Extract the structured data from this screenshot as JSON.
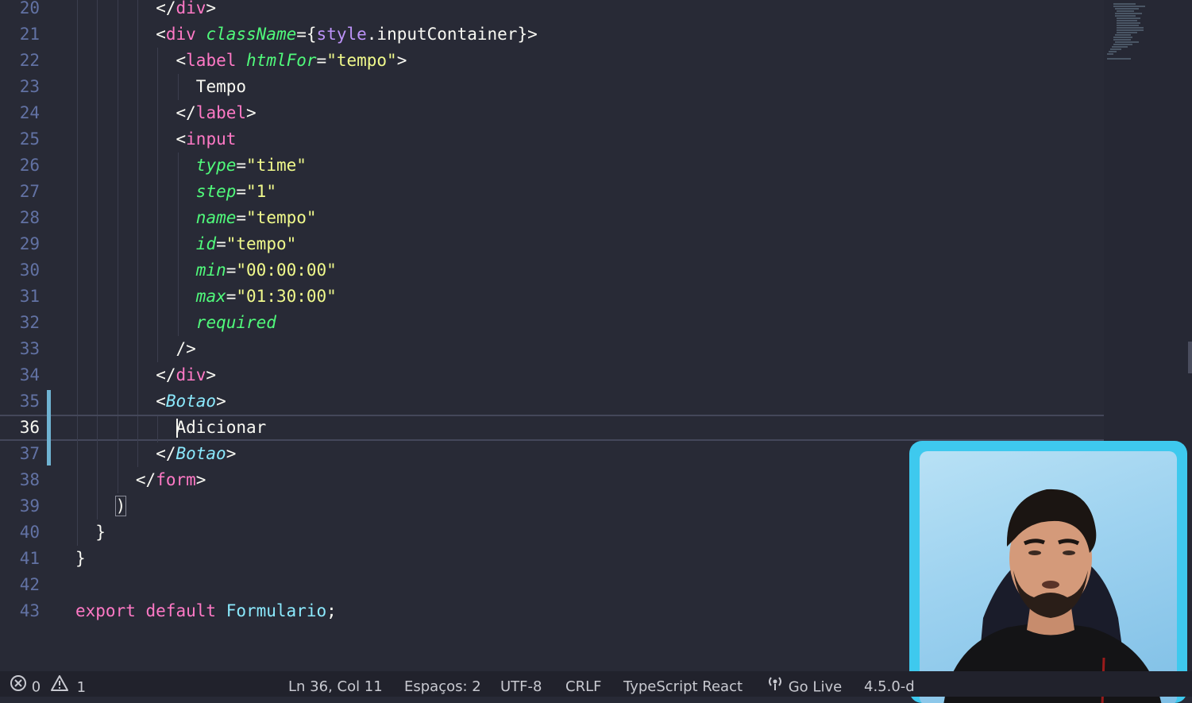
{
  "editor": {
    "lines": [
      {
        "n": "20",
        "tokens": [
          [
            "t-punc",
            "</"
          ],
          [
            "t-tag",
            "div"
          ],
          [
            "t-punc",
            ">"
          ]
        ]
      },
      {
        "n": "21",
        "tokens": [
          [
            "t-punc",
            "<"
          ],
          [
            "t-tag",
            "div"
          ],
          [
            "t-text",
            " "
          ],
          [
            "t-attr",
            "className"
          ],
          [
            "t-punc",
            "="
          ],
          [
            "t-brace",
            "{"
          ],
          [
            "t-var",
            "style"
          ],
          [
            "t-punc",
            "."
          ],
          [
            "t-text",
            "inputContainer"
          ],
          [
            "t-brace",
            "}"
          ],
          [
            "t-punc",
            ">"
          ]
        ]
      },
      {
        "n": "22",
        "tokens": [
          [
            "t-punc",
            "<"
          ],
          [
            "t-tag",
            "label"
          ],
          [
            "t-text",
            " "
          ],
          [
            "t-attr",
            "htmlFor"
          ],
          [
            "t-punc",
            "="
          ],
          [
            "t-str",
            "\"tempo\""
          ],
          [
            "t-punc",
            ">"
          ]
        ]
      },
      {
        "n": "23",
        "tokens": [
          [
            "t-text",
            "Tempo"
          ]
        ]
      },
      {
        "n": "24",
        "tokens": [
          [
            "t-punc",
            "</"
          ],
          [
            "t-tag",
            "label"
          ],
          [
            "t-punc",
            ">"
          ]
        ]
      },
      {
        "n": "25",
        "tokens": [
          [
            "t-punc",
            "<"
          ],
          [
            "t-tag",
            "input"
          ]
        ]
      },
      {
        "n": "26",
        "tokens": [
          [
            "t-attr",
            "type"
          ],
          [
            "t-punc",
            "="
          ],
          [
            "t-str",
            "\"time\""
          ]
        ]
      },
      {
        "n": "27",
        "tokens": [
          [
            "t-attr",
            "step"
          ],
          [
            "t-punc",
            "="
          ],
          [
            "t-str",
            "\"1\""
          ]
        ]
      },
      {
        "n": "28",
        "tokens": [
          [
            "t-attr",
            "name"
          ],
          [
            "t-punc",
            "="
          ],
          [
            "t-str",
            "\"tempo\""
          ]
        ]
      },
      {
        "n": "29",
        "tokens": [
          [
            "t-attr",
            "id"
          ],
          [
            "t-punc",
            "="
          ],
          [
            "t-str",
            "\"tempo\""
          ]
        ]
      },
      {
        "n": "30",
        "tokens": [
          [
            "t-attr",
            "min"
          ],
          [
            "t-punc",
            "="
          ],
          [
            "t-str",
            "\"00:00:00\""
          ]
        ]
      },
      {
        "n": "31",
        "tokens": [
          [
            "t-attr",
            "max"
          ],
          [
            "t-punc",
            "="
          ],
          [
            "t-str",
            "\"01:30:00\""
          ]
        ]
      },
      {
        "n": "32",
        "tokens": [
          [
            "t-attr",
            "required"
          ]
        ]
      },
      {
        "n": "33",
        "tokens": [
          [
            "t-punc",
            "/>"
          ]
        ]
      },
      {
        "n": "34",
        "tokens": [
          [
            "t-punc",
            "</"
          ],
          [
            "t-tag",
            "div"
          ],
          [
            "t-punc",
            ">"
          ]
        ]
      },
      {
        "n": "35",
        "tokens": [
          [
            "t-punc",
            "<"
          ],
          [
            "t-comp",
            "Botao"
          ],
          [
            "t-punc",
            ">"
          ]
        ]
      },
      {
        "n": "36",
        "tokens": [
          [
            "t-text",
            "Adicionar"
          ]
        ]
      },
      {
        "n": "37",
        "tokens": [
          [
            "t-punc",
            "</"
          ],
          [
            "t-comp",
            "Botao"
          ],
          [
            "t-punc",
            ">"
          ]
        ]
      },
      {
        "n": "38",
        "tokens": [
          [
            "t-punc",
            "</"
          ],
          [
            "t-tag",
            "form"
          ],
          [
            "t-punc",
            ">"
          ]
        ]
      },
      {
        "n": "39",
        "tokens": [
          [
            "t-brace t-bracket-hl",
            ")"
          ]
        ]
      },
      {
        "n": "40",
        "tokens": [
          [
            "t-brace",
            "}"
          ]
        ]
      },
      {
        "n": "41",
        "tokens": [
          [
            "t-brace",
            "}"
          ]
        ]
      },
      {
        "n": "42",
        "tokens": []
      },
      {
        "n": "43",
        "tokens": [
          [
            "t-kw",
            "export"
          ],
          [
            "t-text",
            " "
          ],
          [
            "t-kw",
            "default"
          ],
          [
            "t-text",
            " "
          ],
          [
            "t-ident",
            "Formulario"
          ],
          [
            "t-punc",
            ";"
          ]
        ]
      }
    ],
    "current_line": "36"
  },
  "statusbar": {
    "errors": "0",
    "warnings": "1",
    "cursor_position": "Ln 36, Col 11",
    "spaces": "Espaços: 2",
    "encoding": "UTF-8",
    "eol": "CRLF",
    "language": "TypeScript React",
    "go_live": "Go Live",
    "version": "4.5.0-d"
  },
  "colors": {
    "background": "#282a36",
    "statusbar": "#21222c",
    "webcam_border": "#3ec9ee"
  }
}
